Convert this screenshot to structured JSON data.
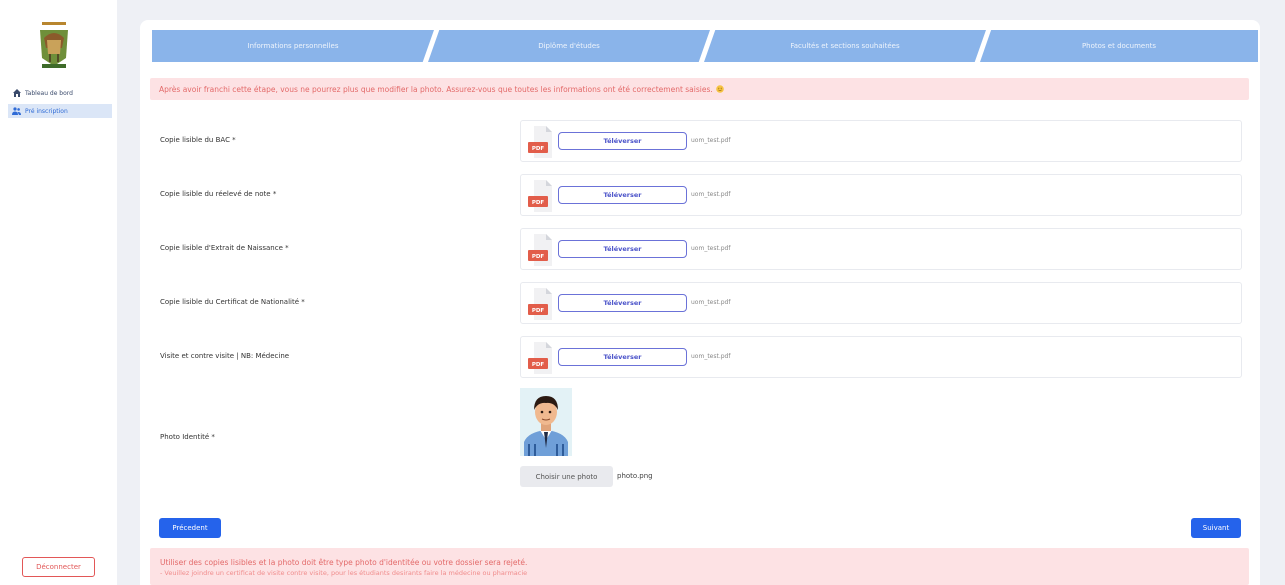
{
  "sidebar": {
    "logo": "university-logo",
    "items": [
      {
        "label": "Tableau de bord",
        "icon": "home-icon"
      },
      {
        "label": "Pré inscription",
        "icon": "users-icon",
        "active": true
      }
    ],
    "logout_label": "Déconnecter"
  },
  "steps": [
    {
      "label": "Informations personnelles"
    },
    {
      "label": "Diplôme d'études"
    },
    {
      "label": "Facultés et sections souhaitées"
    },
    {
      "label": "Photos et documents"
    }
  ],
  "alert_top": "Après avoir franchi cette étape, vous ne pourrez plus que modifier la photo. Assurez-vous que toutes les informations ont été correctement saisies.",
  "documents": [
    {
      "label": "Copie lisible du BAC *",
      "button": "Téléverser",
      "file": "uom_test.pdf"
    },
    {
      "label": "Copie lisible du réelevé de note *",
      "button": "Téléverser",
      "file": "uom_test.pdf"
    },
    {
      "label": "Copie lisible d'Extrait de Naissance *",
      "button": "Téléverser",
      "file": "uom_test.pdf"
    },
    {
      "label": "Copie lisible du Certificat de Nationalité *",
      "button": "Téléverser",
      "file": "uom_test.pdf"
    },
    {
      "label": "Visite et contre visite | NB: Médecine",
      "button": "Téléverser",
      "file": "uom_test.pdf"
    }
  ],
  "photo": {
    "label": "Photo Identité *",
    "button": "Choisir une photo",
    "file": "photo.png"
  },
  "nav": {
    "prev": "Précedent",
    "next": "Suivant"
  },
  "alert_bottom": {
    "line1": "Utiliser des copies lisibles et la photo doit être type photo d'identitée ou votre dossier sera rejeté.",
    "line2": "- Veuillez joindre un certificat de visite contre visite, pour les étudiants desirants faire la médecine ou pharmacie"
  },
  "colors": {
    "primary": "#2563eb",
    "step": "#8ab4ea",
    "alert_bg": "#fde2e4",
    "alert_text": "#e36a6a",
    "pdf": "#e25d4a"
  }
}
